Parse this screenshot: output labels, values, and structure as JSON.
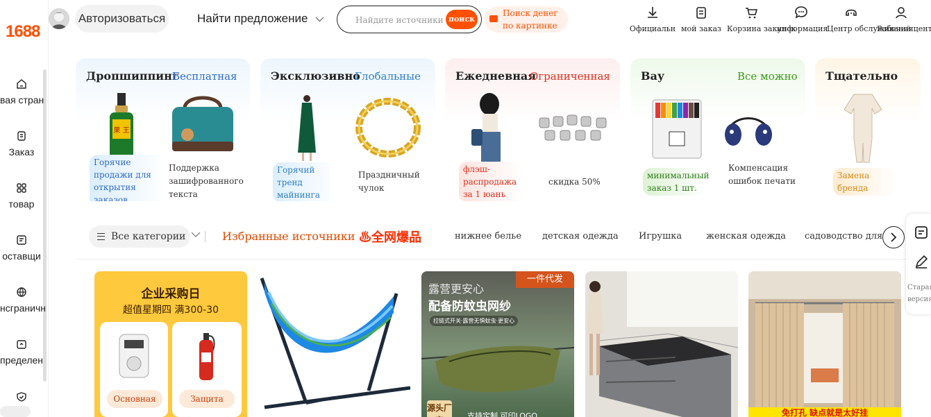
{
  "sidebar": {
    "logo": "1688",
    "items": [
      {
        "label": "вая стран",
        "icon": "home-icon"
      },
      {
        "label": "Заказ",
        "icon": "order-icon"
      },
      {
        "label": "товар",
        "icon": "grid-icon"
      },
      {
        "label": "оставщи",
        "icon": "supplier-icon"
      },
      {
        "label": "нсграничн",
        "icon": "globe-icon"
      },
      {
        "label": "пределен",
        "icon": "distribution-icon"
      },
      {
        "label": "",
        "icon": "shield-icon"
      }
    ]
  },
  "header": {
    "login": "Авторизоваться",
    "find_offer": "Найти предложение",
    "search_placeholder": "Найдите источники п",
    "search_button": "поиск",
    "image_search": "Поиск денег по картинке",
    "icons": [
      {
        "label": "Официальн",
        "icon": "download-icon"
      },
      {
        "label": "мой заказ",
        "icon": "clipboard-icon"
      },
      {
        "label": "Корзина закупок",
        "icon": "cart-icon"
      },
      {
        "label": "информация",
        "icon": "message-icon"
      },
      {
        "label": "Центр обслуживания",
        "icon": "support-icon"
      },
      {
        "label": "Рабочий центр",
        "icon": "user-icon"
      }
    ]
  },
  "promo_cards": [
    {
      "title": "Дропшиппинг",
      "subtitle": "Бесплатная",
      "subtitle_color": "#2f6ac9",
      "left_text": "Горячие продажи для открытия заказов",
      "right_text": "Поддержка зашифрованного текста"
    },
    {
      "title": "Эксклюзивно",
      "subtitle": "Глобальные",
      "subtitle_color": "#2f7fc9",
      "left_text": "Горячий тренд майнинга",
      "right_text": "Праздничный чулок"
    },
    {
      "title": "Ежедневная",
      "subtitle": "Ограниченная",
      "subtitle_color": "#e0301e",
      "left_text": "флэш-распродажа за 1 юань",
      "right_text": "скидка 50%"
    },
    {
      "title": "Вау",
      "subtitle": "Все можно",
      "subtitle_color": "#3a9a1a",
      "left_text": "минимальный заказ 1 шт.",
      "right_text": "Компенсация ошибок печати"
    },
    {
      "title": "Тщательно",
      "subtitle": "",
      "subtitle_color": "#222",
      "left_text": "Замена бренда",
      "right_text": ""
    }
  ],
  "category_bar": {
    "all_categories": "Все категории",
    "favorites": "Избранные источники",
    "hot_label": "全网爆品",
    "categories": [
      "нижнее белье",
      "детская одежда",
      "Игрушка",
      "женская одежда",
      "садоводство для"
    ]
  },
  "products": [
    {
      "banner_title": "企业采购日",
      "banner_sub": "超值星期四 满300-30",
      "item1": "Основная",
      "item2": "Защита"
    },
    {
      "name": "hammock-stand"
    },
    {
      "corner": "一件代发",
      "line1": "露营更安心",
      "line2": "配备防蚊虫网纱",
      "line3": "拉链式开关·露营无惧蚊虫·更安心",
      "badge": "源头厂家",
      "foot": "支持定制 可印LOGO"
    },
    {
      "name": "cabinet"
    },
    {
      "foot": "免打孔 缺点就是太好挂"
    }
  ],
  "floating": {
    "label": "Старая версия"
  }
}
